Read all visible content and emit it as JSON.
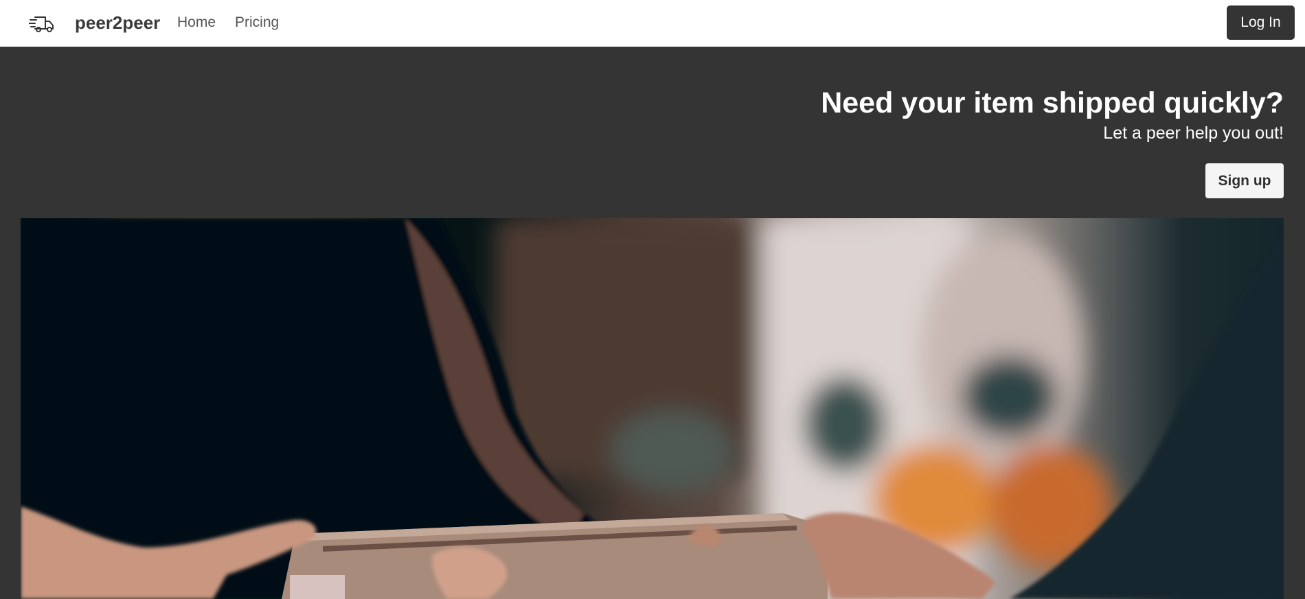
{
  "navbar": {
    "brand": "peer2peer",
    "brand_icon": "truck-icon",
    "links": [
      {
        "label": "Home"
      },
      {
        "label": "Pricing"
      }
    ],
    "login_label": "Log In"
  },
  "hero": {
    "title": "Need your item shipped quickly?",
    "subtitle": "Let a peer help you out!",
    "signup_label": "Sign up",
    "image_description": "hands-exchanging-cardboard-box"
  },
  "colors": {
    "navbar_bg": "#ffffff",
    "hero_bg": "#343434",
    "login_bg": "#343434",
    "signup_bg": "#f5f5f5"
  }
}
